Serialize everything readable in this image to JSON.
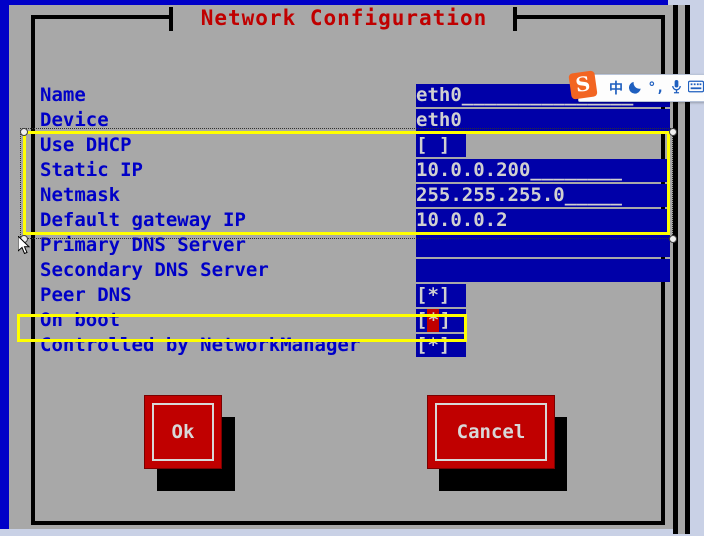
{
  "window": {
    "title": "Network Configuration",
    "title_color": "#c00000",
    "background": "#a8a8a8",
    "frame_color": "#0000c8",
    "field_background": "#0000a8",
    "label_color": "#0000c8",
    "highlight_color": "#ffff00",
    "button_color": "#c00000"
  },
  "form": {
    "rows": [
      {
        "label": "Name",
        "value": "eth0_______________",
        "type": "text",
        "width": "wide"
      },
      {
        "label": "Device",
        "value": "eth0",
        "type": "text",
        "width": "wide"
      },
      {
        "label": "Use DHCP",
        "value": "[ ]",
        "type": "checkbox",
        "checked": false,
        "width": "narrow"
      },
      {
        "label": "Static IP",
        "value": "10.0.0.200________",
        "type": "text",
        "width": "wide"
      },
      {
        "label": "Netmask",
        "value": "255.255.255.0_____",
        "type": "text",
        "width": "wide"
      },
      {
        "label": "Default gateway IP",
        "value": "10.0.0.2",
        "type": "text",
        "width": "wide"
      },
      {
        "label": "Primary DNS Server",
        "value": "",
        "type": "text",
        "width": "wide"
      },
      {
        "label": "Secondary DNS Server",
        "value": "",
        "type": "text",
        "width": "wide"
      },
      {
        "label": "Peer DNS",
        "value": "[*]",
        "type": "checkbox",
        "checked": true,
        "width": "narrow"
      },
      {
        "label": "On boot",
        "value": "[*]",
        "type": "checkbox",
        "checked": true,
        "width": "narrow",
        "cursor": true
      },
      {
        "label": "Controlled by NetworkManager",
        "value": "[*]",
        "type": "checkbox",
        "checked": true,
        "width": "narrow"
      }
    ]
  },
  "buttons": {
    "ok": "Ok",
    "cancel": "Cancel"
  },
  "selection": {
    "group_highlight_rows": [
      "Use DHCP",
      "Static IP",
      "Netmask",
      "Default gateway IP"
    ],
    "focused_row": "On boot"
  },
  "ime": {
    "logo": "S",
    "items": [
      {
        "name": "chinese-mode-icon",
        "glyph": "中"
      },
      {
        "name": "moon-icon",
        "glyph": "☾"
      },
      {
        "name": "punctuation-icon",
        "glyph": "°,"
      },
      {
        "name": "microphone-icon",
        "glyph": "Ἲ4"
      },
      {
        "name": "keyboard-icon",
        "glyph": "⌨"
      }
    ]
  }
}
